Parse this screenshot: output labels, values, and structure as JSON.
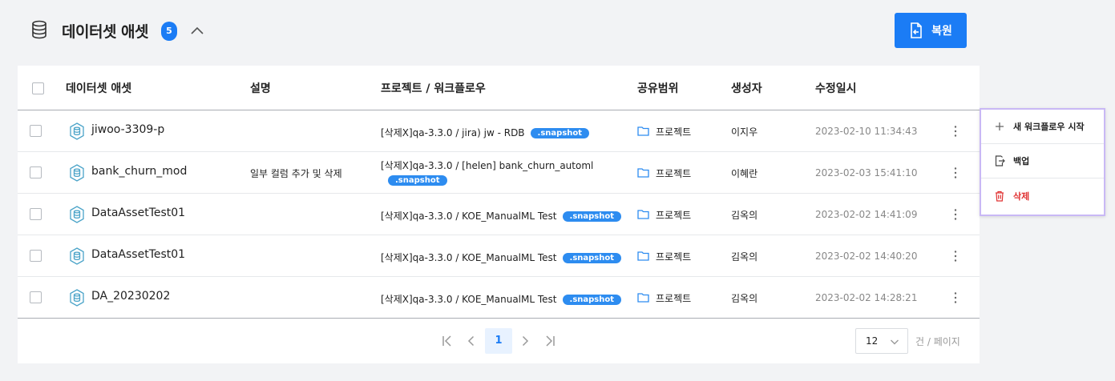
{
  "header": {
    "title": "데이터셋 애셋",
    "count": "5",
    "restore_label": "복원"
  },
  "table": {
    "columns": {
      "name": "데이터셋 애셋",
      "description": "설명",
      "project": "프로젝트 / 워크플로우",
      "share": "공유범위",
      "creator": "생성자",
      "modified": "수정일시"
    },
    "rows": [
      {
        "name": "jiwoo-3309-p",
        "description": "",
        "project_line1": "[삭제X]qa-3.3.0 / jira) jw - RDB",
        "project_line2": "",
        "tag": ".snapshot",
        "share": "프로젝트",
        "creator": "이지우",
        "modified": "2023-02-10 11:34:43"
      },
      {
        "name": "bank_churn_mod",
        "description": "일부 컬럼 추가 및 삭제",
        "project_line1": "[삭제X]qa-3.3.0 / [helen] bank_churn_automl",
        "project_line2": "",
        "tag": ".snapshot",
        "share": "프로젝트",
        "creator": "이혜란",
        "modified": "2023-02-03 15:41:10"
      },
      {
        "name": "DataAssetTest01",
        "description": "",
        "project_line1": "[삭제X]qa-3.3.0 / KOE_ManualML Test",
        "project_line2": "",
        "tag": ".snapshot",
        "share": "프로젝트",
        "creator": "김옥의",
        "modified": "2023-02-02 14:41:09"
      },
      {
        "name": "DataAssetTest01",
        "description": "",
        "project_line1": "[삭제X]qa-3.3.0 / KOE_ManualML Test",
        "project_line2": "",
        "tag": ".snapshot",
        "share": "프로젝트",
        "creator": "김옥의",
        "modified": "2023-02-02 14:40:20"
      },
      {
        "name": "DA_20230202",
        "description": "",
        "project_line1": "[삭제X]qa-3.3.0 / KOE_ManualML Test",
        "project_line2": "",
        "tag": ".snapshot",
        "share": "프로젝트",
        "creator": "김옥의",
        "modified": "2023-02-02 14:28:21"
      }
    ]
  },
  "pagination": {
    "current_page": "1",
    "page_size": "12",
    "per_page_label": "건 / 페이지"
  },
  "context_menu": {
    "items": [
      {
        "label": "새 워크플로우 시작",
        "icon": "plus-icon"
      },
      {
        "label": "백업",
        "icon": "export-icon"
      },
      {
        "label": "삭제",
        "icon": "trash-icon"
      }
    ]
  },
  "colors": {
    "primary": "#1b7cf5",
    "tag": "#2d8cf0",
    "danger": "#e03131",
    "menu_border": "#c9b8f5"
  }
}
